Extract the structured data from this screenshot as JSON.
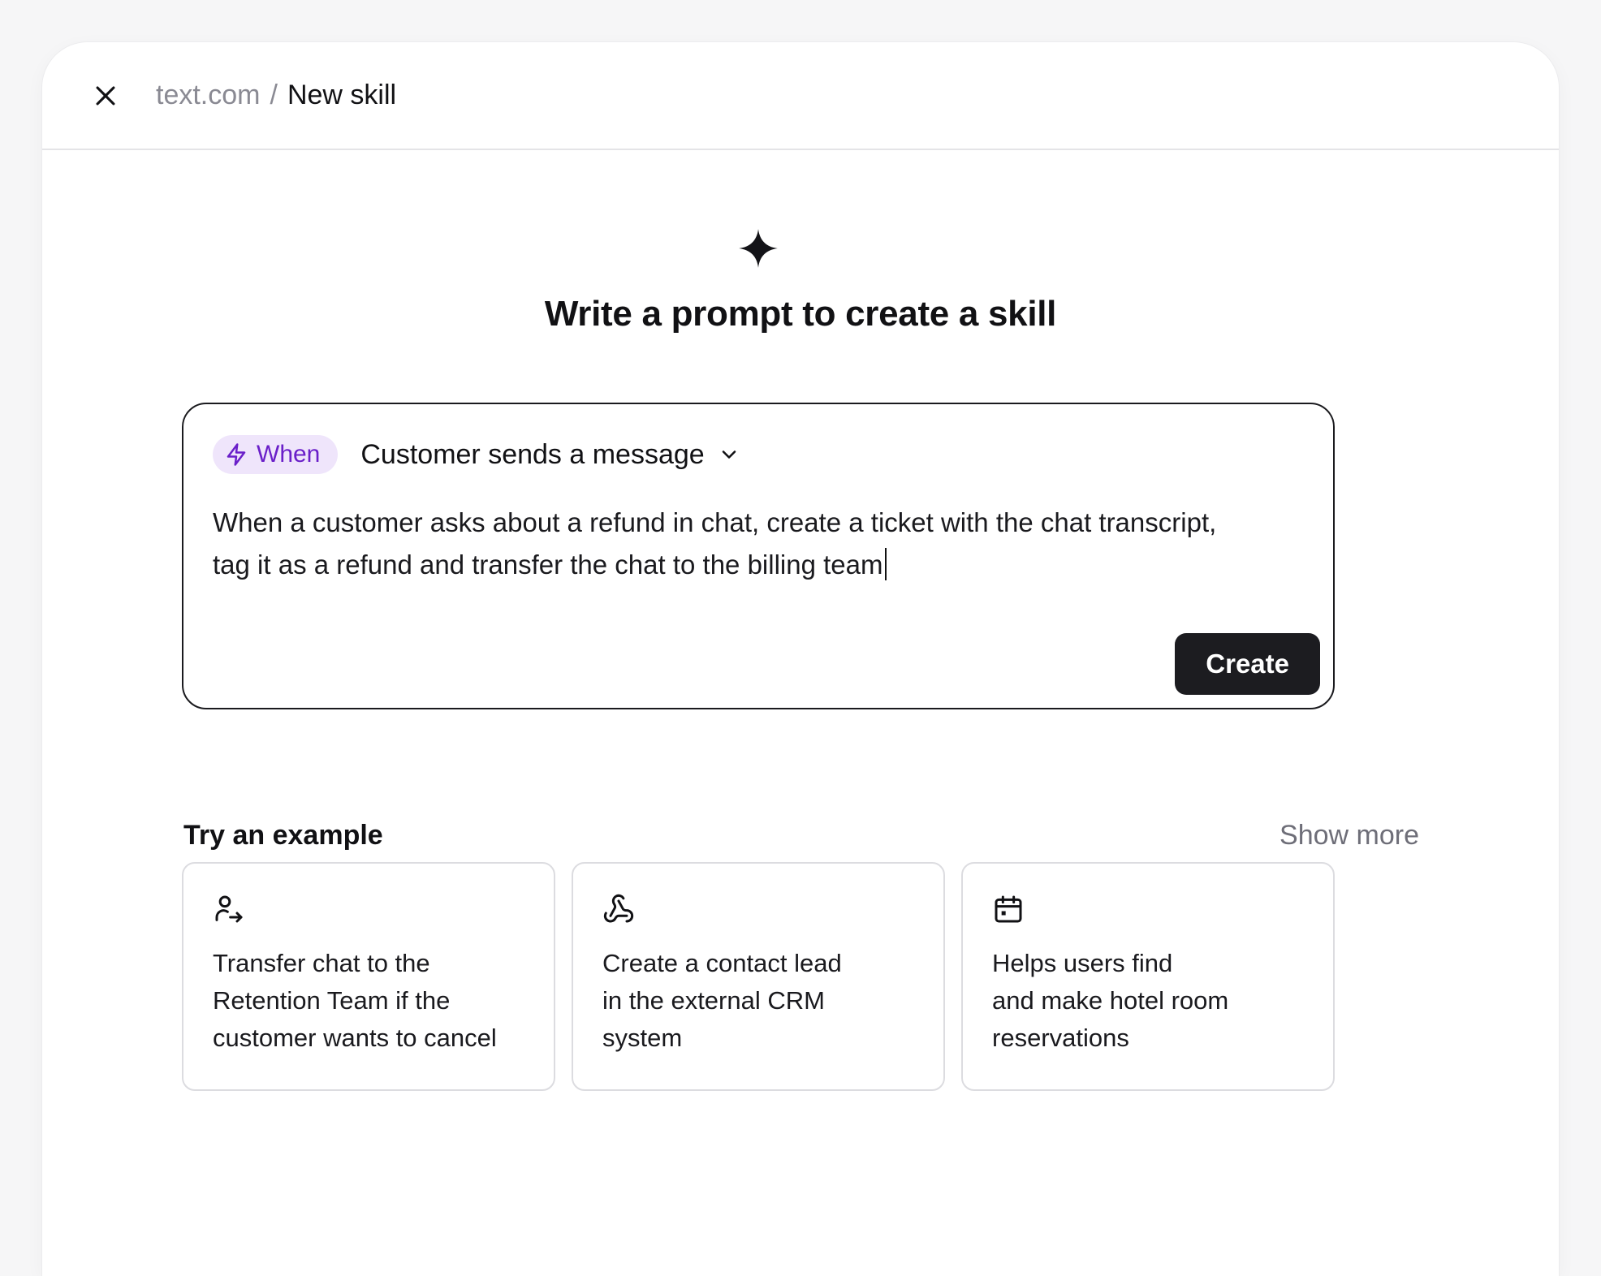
{
  "header": {
    "breadcrumb_root": "text.com",
    "breadcrumb_separator": "/",
    "breadcrumb_current": "New skill"
  },
  "main": {
    "title": "Write a prompt to create a skill"
  },
  "prompt": {
    "trigger_label": "When",
    "trigger_value": "Customer sends a message",
    "text_line1": "When a customer asks about a refund in chat, create a ticket with the chat transcript,",
    "text_line2": "tag it as a refund and transfer the chat to the billing team",
    "create_label": "Create"
  },
  "examples": {
    "title": "Try an example",
    "show_more": "Show more",
    "cards": [
      {
        "icon": "user-transfer-icon",
        "line1": "Transfer chat to the",
        "line2": "Retention Team if the",
        "line3": "customer wants to cancel"
      },
      {
        "icon": "webhook-icon",
        "line1": "Create a contact lead",
        "line2": "in the external CRM",
        "line3": "system"
      },
      {
        "icon": "calendar-icon",
        "line1": "Helps users find",
        "line2": "and make hotel room",
        "line3": "reservations"
      }
    ]
  },
  "colors": {
    "accent_purple": "#6a1fc9",
    "pill_bg": "#efe5fb",
    "primary_button": "#1c1c20"
  }
}
